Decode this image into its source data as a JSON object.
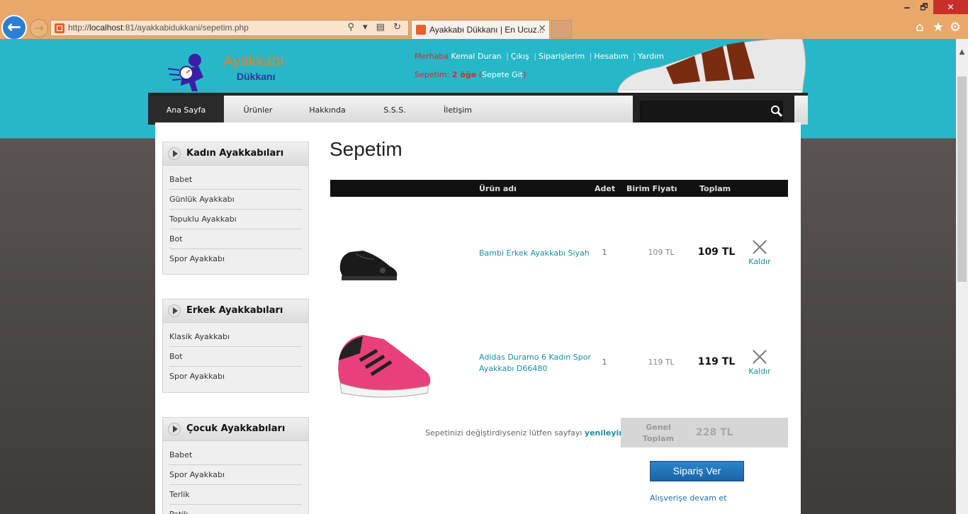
{
  "browser": {
    "url_prefix": "http://",
    "url_host": "localhost",
    "url_rest": ":81/ayakkabidukkani/sepetim.php",
    "tab_title": "Ayakkabı Dükkanı | En Ucuz...",
    "tab_close": "×",
    "address_tools": "⚲ ▾ ▤ ↻"
  },
  "window": {
    "minimize": "🗕",
    "maximize": "🗗",
    "close": "✕"
  },
  "commands": {
    "home": "⌂",
    "favorites": "★",
    "settings": "⚙"
  },
  "logo": {
    "line1": "Ayakkabı",
    "line2": "Dükkanı"
  },
  "user": {
    "greeting": "Merhaba",
    "name": "Kemal Duran",
    "links": [
      "Çıkış",
      "Siparişlerim",
      "Hesabım",
      "Yardım"
    ]
  },
  "cart_summary": {
    "label": "Sepetim:",
    "count": "2 öğe",
    "open": "(",
    "link": "Sepete Git",
    "close": ")"
  },
  "nav": {
    "items": [
      "Ana Sayfa",
      "Ürünler",
      "Hakkında",
      "S.S.S.",
      "İletişim"
    ]
  },
  "search": {
    "placeholder": ""
  },
  "sidebar": {
    "categories": [
      {
        "title": "Kadın Ayakkabıları",
        "items": [
          "Babet",
          "Günlük Ayakkabı",
          "Topuklu Ayakkabı",
          "Bot",
          "Spor Ayakkabı"
        ]
      },
      {
        "title": "Erkek Ayakkabıları",
        "items": [
          "Klasik Ayakkabı",
          "Bot",
          "Spor Ayakkabı"
        ]
      },
      {
        "title": "Çocuk Ayakkabıları",
        "items": [
          "Babet",
          "Spor Ayakkabı",
          "Terlik",
          "Patik"
        ]
      }
    ]
  },
  "cart": {
    "title": "Sepetim",
    "headers": {
      "name": "Ürün adı",
      "qty": "Adet",
      "unit": "Birim Fiyatı",
      "total": "Toplam"
    },
    "items": [
      {
        "name": "Bambi Erkek Ayakkabı Siyah",
        "qty": "1",
        "unit_price": "109 TL",
        "total": "109 TL",
        "remove": "Kaldır"
      },
      {
        "name": "Adidas Duramo 6 Kadın Spor Ayakkabı D66480",
        "qty": "1",
        "unit_price": "119 TL",
        "total": "119 TL",
        "remove": "Kaldır"
      }
    ],
    "refresh_note": "Sepetinizi değiştirdiyseniz lütfen sayfayı",
    "refresh_link": "yenileyiniz",
    "grand_total_label": "Genel Toplam",
    "grand_total_value": "228 TL",
    "order_button": "Sipariş Ver",
    "continue_link": "Alışverişe devam et"
  }
}
